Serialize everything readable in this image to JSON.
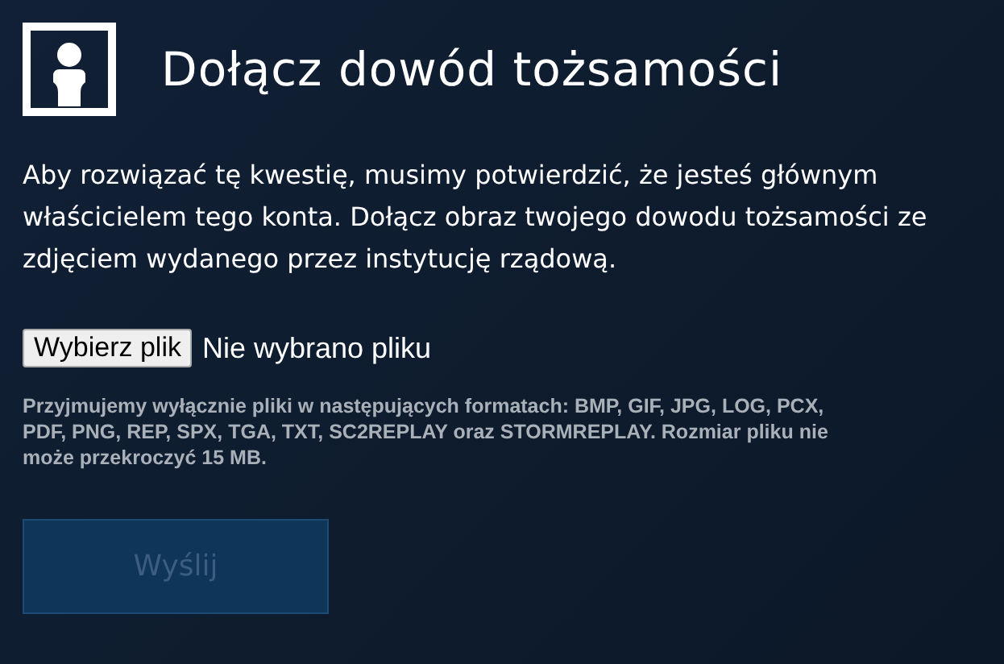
{
  "header": {
    "title": "Dołącz dowód tożsamości"
  },
  "intro": "Aby rozwiązać tę kwestię, musimy potwierdzić, że jesteś głównym właścicielem tego konta. Dołącz obraz twojego dowodu tożsamości ze zdjęciem wydanego przez instytucję rządową.",
  "file_input": {
    "button": "Wybierz plik",
    "status": "Nie wybrano pliku"
  },
  "note": "Przyjmujemy wyłącznie pliki w następujących formatach: BMP, GIF, JPG, LOG, PCX, PDF, PNG, REP, SPX, TGA, TXT, SC2REPLAY oraz STORMREPLAY. Rozmiar pliku nie może przekroczyć 15 MB.",
  "submit": {
    "label": "Wyślij",
    "disabled": true
  }
}
